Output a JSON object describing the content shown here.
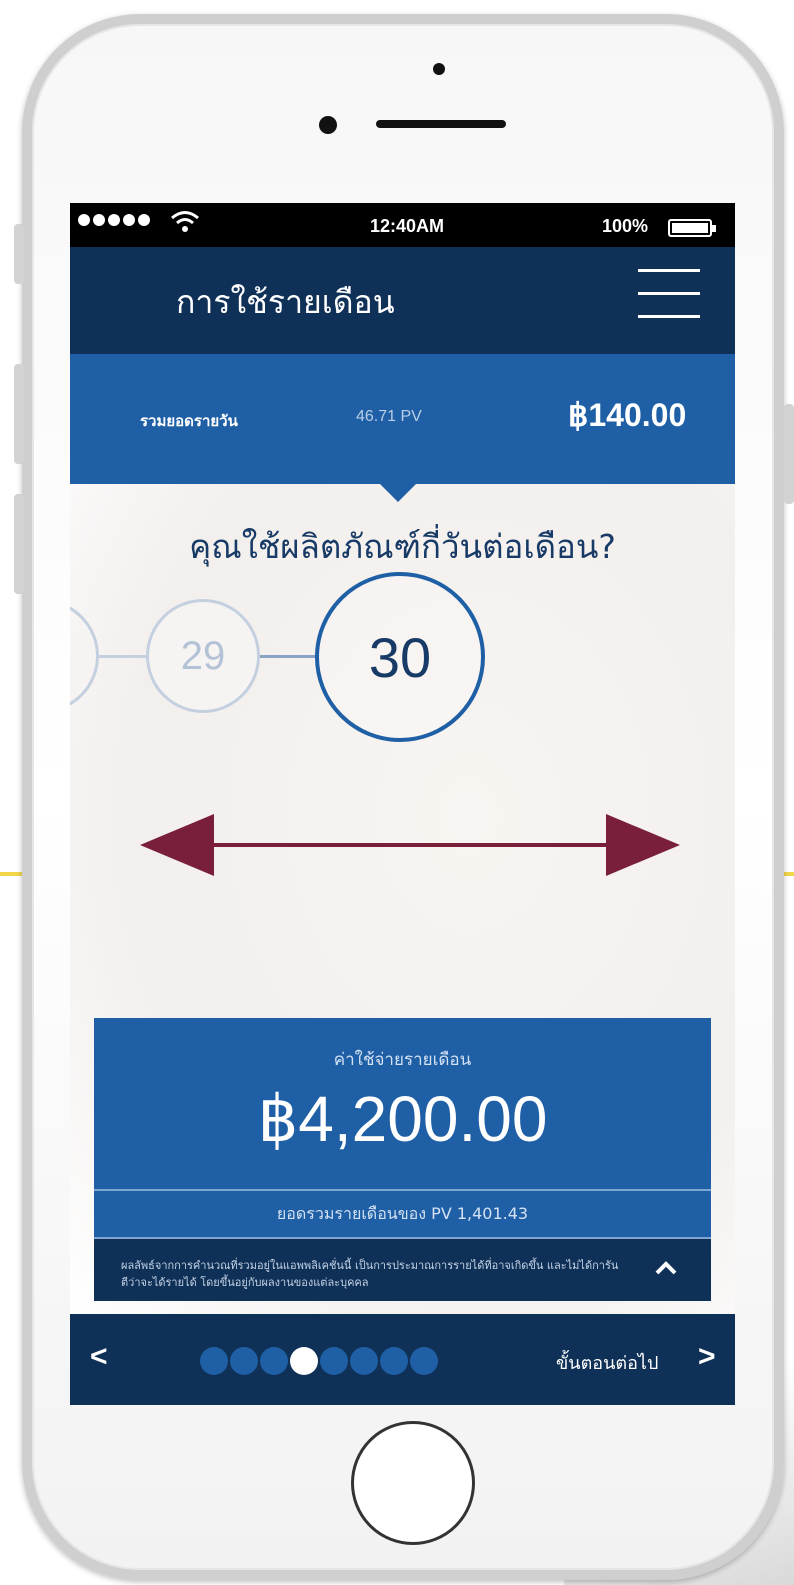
{
  "status_bar": {
    "time": "12:40AM",
    "battery": "100%",
    "wifi_icon": "wifi-icon"
  },
  "header": {
    "title": "การใช้รายเดือน",
    "menu_icon": "hamburger-menu-icon"
  },
  "summary": {
    "label": "รวมยอดรายวัน",
    "pv": "46.71 PV",
    "total": "฿140.00"
  },
  "question": "คุณใช้ผลิตภัณฑ์กี่วันต่อเดือน?",
  "day_picker": {
    "previous_value": "29",
    "current_value": "30",
    "swipe_icon": "double-arrow-icon",
    "arrow_color": "#7a1f3a"
  },
  "monthly_cost": {
    "label": "ค่าใช้จ่ายรายเดือน",
    "amount": "฿4,200.00",
    "pv_total": "ยอดรวมรายเดือนของ PV 1,401.43"
  },
  "disclaimer": {
    "text": "ผลลัพธ์จากการคำนวณที่รวมอยู่ในแอพพลิเคชั่นนี้ เป็นการประมาณการรายได้ที่อาจเกิดขึ้น และไม่ได้การันตีว่าจะได้รายได้ โดยขึ้นอยู่กับผลงานของแต่ละบุคคล",
    "toggle_icon": "chevron-up-icon"
  },
  "bottom_nav": {
    "prev_symbol": "<",
    "next_label": "ขั้นตอนต่อไป",
    "next_symbol": ">",
    "total_steps": 8,
    "current_step": 4
  },
  "colors": {
    "navy": "#0f3057",
    "blue": "#1f5fa6",
    "accent_yellow": "#f2d74a"
  }
}
